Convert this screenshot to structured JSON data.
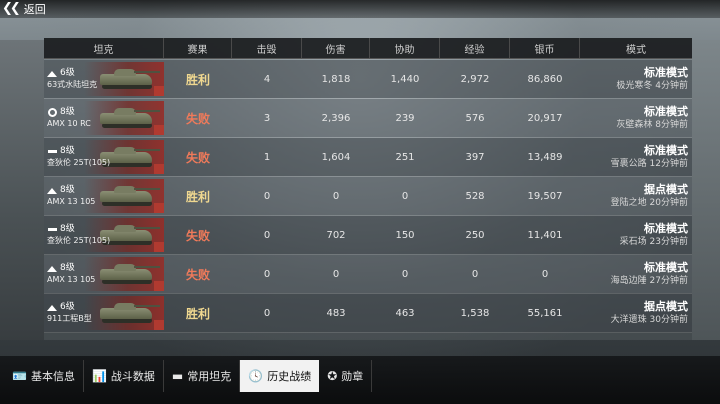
{
  "header": {
    "back_label": "返回"
  },
  "table": {
    "columns": [
      "坦克",
      "赛果",
      "击毁",
      "伤害",
      "协助",
      "经验",
      "银币",
      "模式"
    ],
    "rows": [
      {
        "class_icon": "light-tank-icon",
        "tier": "6级",
        "tank": "63式水陆坦克",
        "result": "胜利",
        "result_type": "win",
        "kills": "4",
        "damage": "1,818",
        "assist": "1,440",
        "exp": "2,972",
        "silver": "86,860",
        "mode": "标准模式",
        "map_time": "极光寒冬 4分钟前"
      },
      {
        "class_icon": "heavy-tank-icon",
        "tier": "8级",
        "tank": "AMX 10 RC",
        "result": "失败",
        "result_type": "lose",
        "kills": "3",
        "damage": "2,396",
        "assist": "239",
        "exp": "576",
        "silver": "20,917",
        "mode": "标准模式",
        "map_time": "灰壁森林 8分钟前"
      },
      {
        "class_icon": "td-icon",
        "tier": "8级",
        "tank": "查狄伦 25T(105)",
        "result": "失败",
        "result_type": "lose",
        "kills": "1",
        "damage": "1,604",
        "assist": "251",
        "exp": "397",
        "silver": "13,489",
        "mode": "标准模式",
        "map_time": "雪裹公路 12分钟前"
      },
      {
        "class_icon": "light-tank-icon",
        "tier": "8级",
        "tank": "AMX 13 105",
        "result": "胜利",
        "result_type": "win",
        "kills": "0",
        "damage": "0",
        "assist": "0",
        "exp": "528",
        "silver": "19,507",
        "mode": "据点模式",
        "map_time": "登陆之地 20分钟前"
      },
      {
        "class_icon": "td-icon",
        "tier": "8级",
        "tank": "查狄伦 25T(105)",
        "result": "失败",
        "result_type": "lose",
        "kills": "0",
        "damage": "702",
        "assist": "150",
        "exp": "250",
        "silver": "11,401",
        "mode": "标准模式",
        "map_time": "采石场 23分钟前"
      },
      {
        "class_icon": "light-tank-icon",
        "tier": "8级",
        "tank": "AMX 13 105",
        "result": "失败",
        "result_type": "lose",
        "kills": "0",
        "damage": "0",
        "assist": "0",
        "exp": "0",
        "silver": "0",
        "mode": "标准模式",
        "map_time": "海岛边陲 27分钟前"
      },
      {
        "class_icon": "light-tank-icon",
        "tier": "6级",
        "tank": "911工程B型",
        "result": "胜利",
        "result_type": "win",
        "kills": "0",
        "damage": "483",
        "assist": "463",
        "exp": "1,538",
        "silver": "55,161",
        "mode": "据点模式",
        "map_time": "大洋遗珠 30分钟前"
      }
    ]
  },
  "tabs": [
    {
      "label": "基本信息",
      "icon": "id-card-icon",
      "active": false
    },
    {
      "label": "战斗数据",
      "icon": "bar-chart-icon",
      "active": false
    },
    {
      "label": "常用坦克",
      "icon": "tank-icon",
      "active": false
    },
    {
      "label": "历史战绩",
      "icon": "clock-icon",
      "active": true
    },
    {
      "label": "勋章",
      "icon": "medal-icon",
      "active": false
    }
  ],
  "colors": {
    "win": "#f0d890",
    "lose": "#f07a5a",
    "active_tab_bg": "#f2f2f2"
  }
}
